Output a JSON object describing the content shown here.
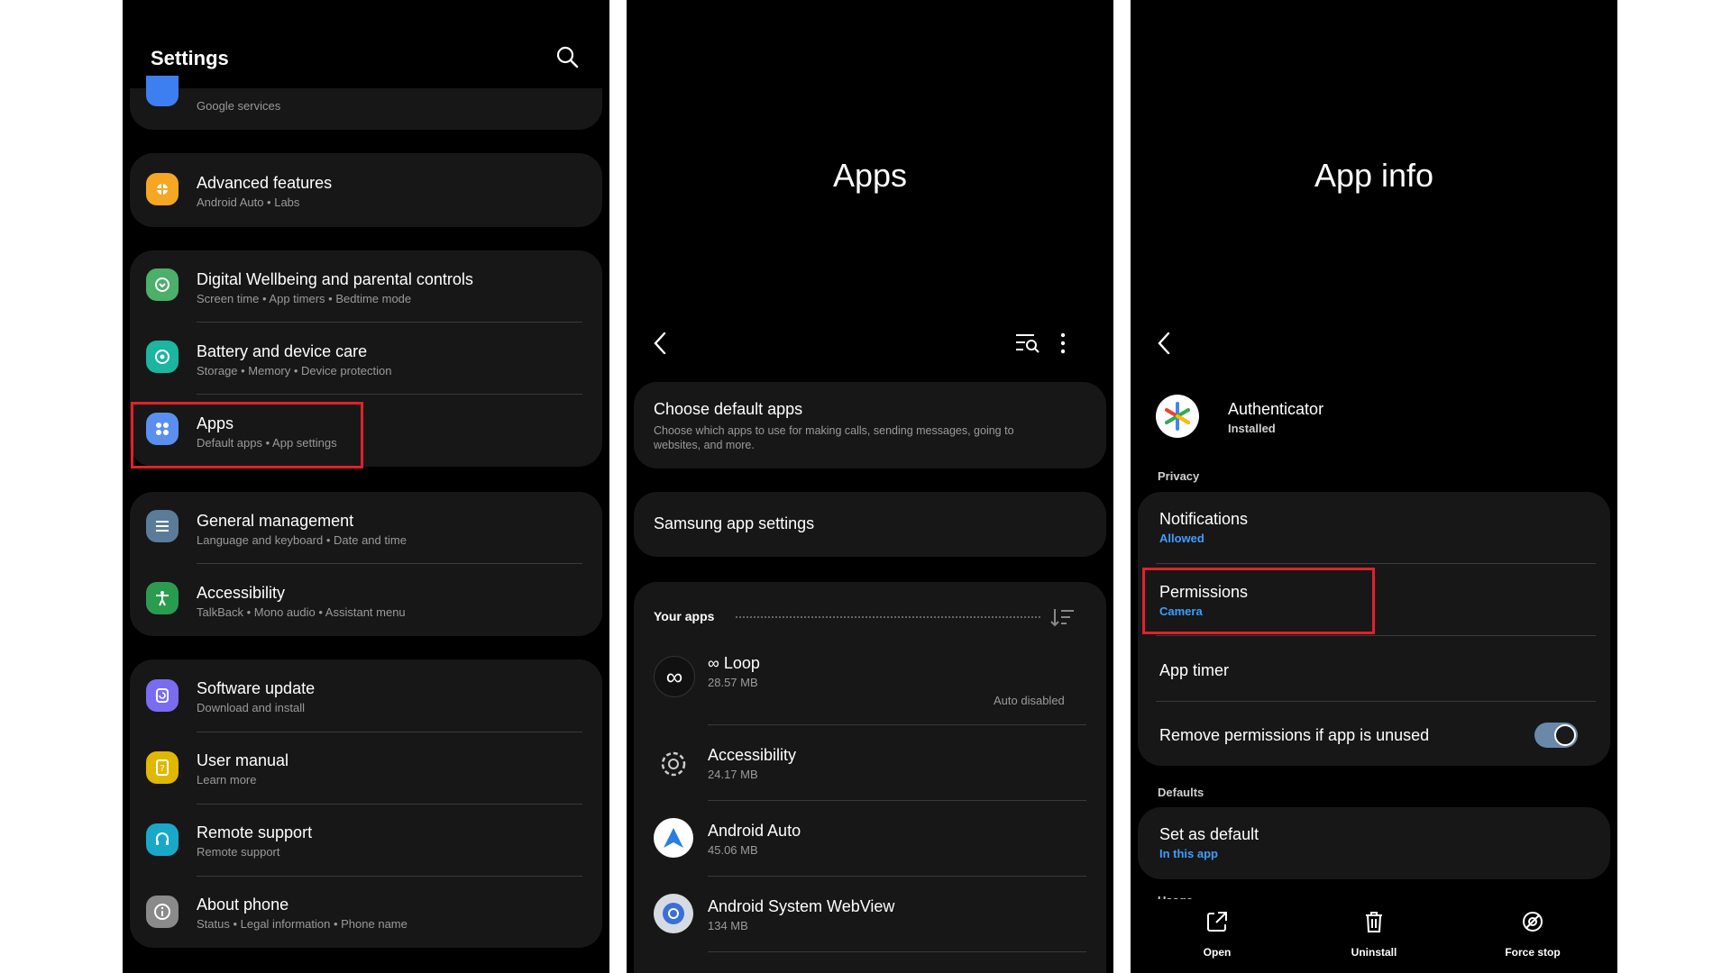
{
  "settings": {
    "title": "Settings",
    "items": [
      {
        "label": "",
        "sub": "Google services"
      },
      {
        "label": "Advanced features",
        "sub": "Android Auto  •  Labs"
      },
      {
        "label": "Digital Wellbeing and parental controls",
        "sub": "Screen time  •  App timers  •  Bedtime mode"
      },
      {
        "label": "Battery and device care",
        "sub": "Storage  •  Memory  •  Device protection"
      },
      {
        "label": "Apps",
        "sub": "Default apps  •  App settings"
      },
      {
        "label": "General management",
        "sub": "Language and keyboard  •  Date and time"
      },
      {
        "label": "Accessibility",
        "sub": "TalkBack  •  Mono audio  •  Assistant menu"
      },
      {
        "label": "Software update",
        "sub": "Download and install"
      },
      {
        "label": "User manual",
        "sub": "Learn more"
      },
      {
        "label": "Remote support",
        "sub": "Remote support"
      },
      {
        "label": "About phone",
        "sub": "Status  •  Legal information  •  Phone name"
      }
    ]
  },
  "apps": {
    "title": "Apps",
    "choose_default": {
      "label": "Choose default apps",
      "sub": "Choose which apps to use for making calls, sending messages, going to websites, and more."
    },
    "samsung_settings": "Samsung app settings",
    "your_apps": "Your apps",
    "list": [
      {
        "name": "∞ Loop",
        "size": "28.57 MB",
        "note": "Auto disabled"
      },
      {
        "name": "Accessibility",
        "size": "24.17 MB"
      },
      {
        "name": "Android Auto",
        "size": "45.06 MB"
      },
      {
        "name": "Android System WebView",
        "size": "134 MB"
      }
    ]
  },
  "app_info": {
    "title": "App info",
    "app_name": "Authenticator",
    "app_status": "Installed",
    "privacy_header": "Privacy",
    "notifications": {
      "label": "Notifications",
      "value": "Allowed"
    },
    "permissions": {
      "label": "Permissions",
      "value": "Camera"
    },
    "app_timer": "App timer",
    "remove_permissions": {
      "label": "Remove permissions if app is unused",
      "enabled": true
    },
    "defaults_header": "Defaults",
    "set_default": {
      "label": "Set as default",
      "value": "In this app"
    },
    "usage_header_partial": "Usage",
    "bottom": {
      "open": "Open",
      "uninstall": "Uninstall",
      "force_stop": "Force stop"
    }
  },
  "colors": {
    "highlight": "#e3202a",
    "accent_blue": "#3d9eff",
    "card": "#171717"
  }
}
